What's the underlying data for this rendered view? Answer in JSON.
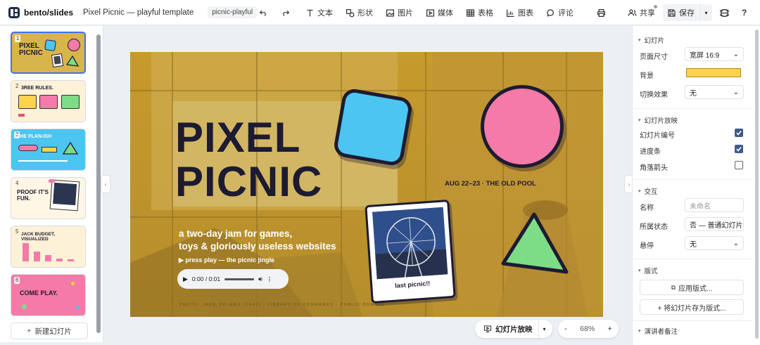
{
  "app": {
    "logo_text": "bento/slides",
    "doc_title": "Pixel Picnic — playful template",
    "chip": "picnic-playful"
  },
  "toolbar": {
    "text": "文本",
    "shape": "形状",
    "image": "图片",
    "media": "媒体",
    "table": "表格",
    "chart": "图表",
    "comment": "评论",
    "share": "共享",
    "save": "保存",
    "help": "?"
  },
  "slides": [
    {
      "num": "1",
      "title": "PIXEL PICNIC"
    },
    {
      "num": "2",
      "title": "3REE RULES."
    },
    {
      "num": "3",
      "title": "THE PLAN-ISH"
    },
    {
      "num": "4",
      "title": "PROOF IT'S FUN."
    },
    {
      "num": "5",
      "title": "JACK BUDGET, VISUALIZED"
    },
    {
      "num": "6",
      "title": "COME PLAY."
    }
  ],
  "new_slide": "新建幻灯片",
  "slide": {
    "title_line1": "PIXEL",
    "title_line2": "PICNIC",
    "subtitle_line1": "a two-day jam for games,",
    "subtitle_line2": "toys & gloriously useless websites",
    "press_play": "▶ press play — the picnic jingle",
    "date": "AUG 22–23 · THE OLD POOL",
    "polaroid_caption": "last picnic!!",
    "audio_time": "0:00 / 0:01",
    "photo_credit": "PHOTO: JACK DELANO (1941) · LIBRARY OF CONGRESS · PUBLIC DOMAIN"
  },
  "bottom": {
    "slideshow": "幻灯片放映",
    "zoom": "68%",
    "minus": "-",
    "plus": "+"
  },
  "panel": {
    "sec_slide": "幻灯片",
    "page_size_label": "页面尺寸",
    "page_size_value": "宽屏 16:9",
    "bg_label": "背景",
    "bg_color": "#fcd34d",
    "transition_label": "切换效果",
    "transition_value": "无",
    "sec_show": "幻灯片放映",
    "slide_num_label": "幻灯片编号",
    "progress_label": "进度条",
    "corner_label": "角落箭头",
    "sec_interaction": "交互",
    "name_label": "名称",
    "name_placeholder": "未命名",
    "state_label": "所属状态",
    "state_value": "否 — 普通幻灯片",
    "hover_label": "悬停",
    "hover_value": "无",
    "sec_layout": "版式",
    "apply_layout": "应用版式...",
    "save_layout": "+ 将幻灯片存为版式...",
    "sec_notes": "演讲者备注"
  },
  "colors": {
    "accent": "#3b73f0",
    "slide_bg": "#c9a63a",
    "square": "#4cc6f0",
    "circle": "#f47aa8",
    "triangle": "#7ddd86",
    "text_dark": "#1d1b32"
  }
}
